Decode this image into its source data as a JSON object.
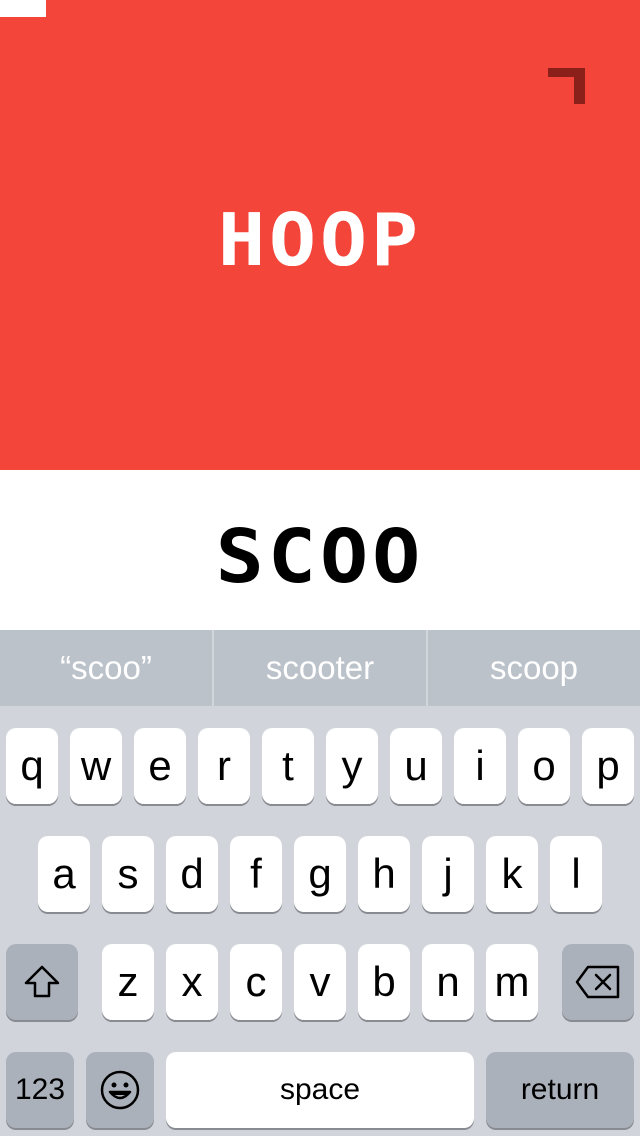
{
  "colors": {
    "brand_red": "#f4453a",
    "corner_mark": "#8b1f1a"
  },
  "game": {
    "target_word": "HOOP",
    "typed_word": "SCOO"
  },
  "suggestions": [
    "“scoo”",
    "scooter",
    "scoop"
  ],
  "keyboard": {
    "row1": [
      "q",
      "w",
      "e",
      "r",
      "t",
      "y",
      "u",
      "i",
      "o",
      "p"
    ],
    "row2": [
      "a",
      "s",
      "d",
      "f",
      "g",
      "h",
      "j",
      "k",
      "l"
    ],
    "row3": [
      "z",
      "x",
      "c",
      "v",
      "b",
      "n",
      "m"
    ],
    "numbers_label": "123",
    "space_label": "space",
    "return_label": "return",
    "icons": {
      "shift": "shift-icon",
      "backspace": "backspace-icon",
      "emoji": "emoji-icon"
    }
  }
}
